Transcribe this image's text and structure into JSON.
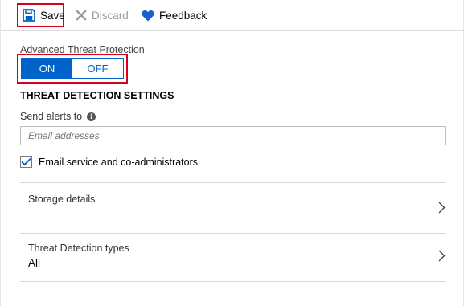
{
  "toolbar": {
    "save_label": "Save",
    "discard_label": "Discard",
    "feedback_label": "Feedback"
  },
  "atp": {
    "label": "Advanced Threat Protection",
    "on_label": "ON",
    "off_label": "OFF",
    "selected": "ON"
  },
  "settings": {
    "heading": "THREAT DETECTION SETTINGS",
    "send_alerts_label": "Send alerts to",
    "email_placeholder": "Email addresses",
    "email_value": "",
    "email_admins_label": "Email service and co-administrators",
    "email_admins_checked": true
  },
  "storage": {
    "title": "Storage details"
  },
  "detection_types": {
    "title": "Threat Detection types",
    "value": "All"
  },
  "colors": {
    "accent": "#0063c9",
    "highlight": "#d8001c",
    "heart": "#1a5fd0"
  }
}
